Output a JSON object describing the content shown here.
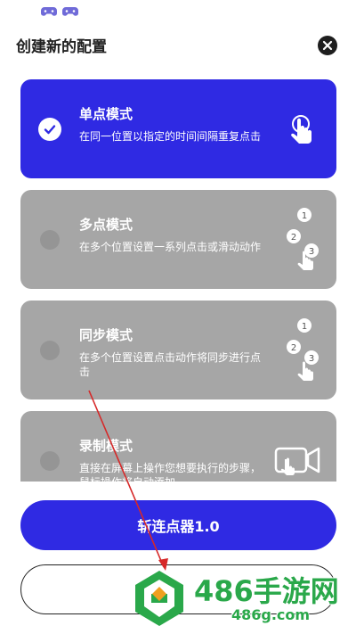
{
  "header": {
    "title": "创建新的配置"
  },
  "modes": [
    {
      "title": "单点模式",
      "description": "在同一位置以指定的时间间隔重复点击",
      "selected": true,
      "icon": "single-tap-icon"
    },
    {
      "title": "多点模式",
      "description": "在多个位置设置一系列点击或滑动动作",
      "selected": false,
      "icon": "multi-tap-icon"
    },
    {
      "title": "同步模式",
      "description": "在多个位置设置点击动作将同步进行点击",
      "selected": false,
      "icon": "sync-tap-icon"
    },
    {
      "title": "录制模式",
      "description": "直接在屏幕上操作您想要执行的步骤，鼠标操作将自动添加",
      "selected": false,
      "icon": "record-icon"
    }
  ],
  "actions": {
    "primary_label": "斩连点器1.0"
  },
  "watermark": {
    "brand": "486手游网",
    "url": "486g.com"
  },
  "colors": {
    "accent": "#2f2ae3",
    "card_inactive": "#a6a6a6",
    "watermark_green": "#2aa84a",
    "annotation_arrow": "#d62828"
  }
}
